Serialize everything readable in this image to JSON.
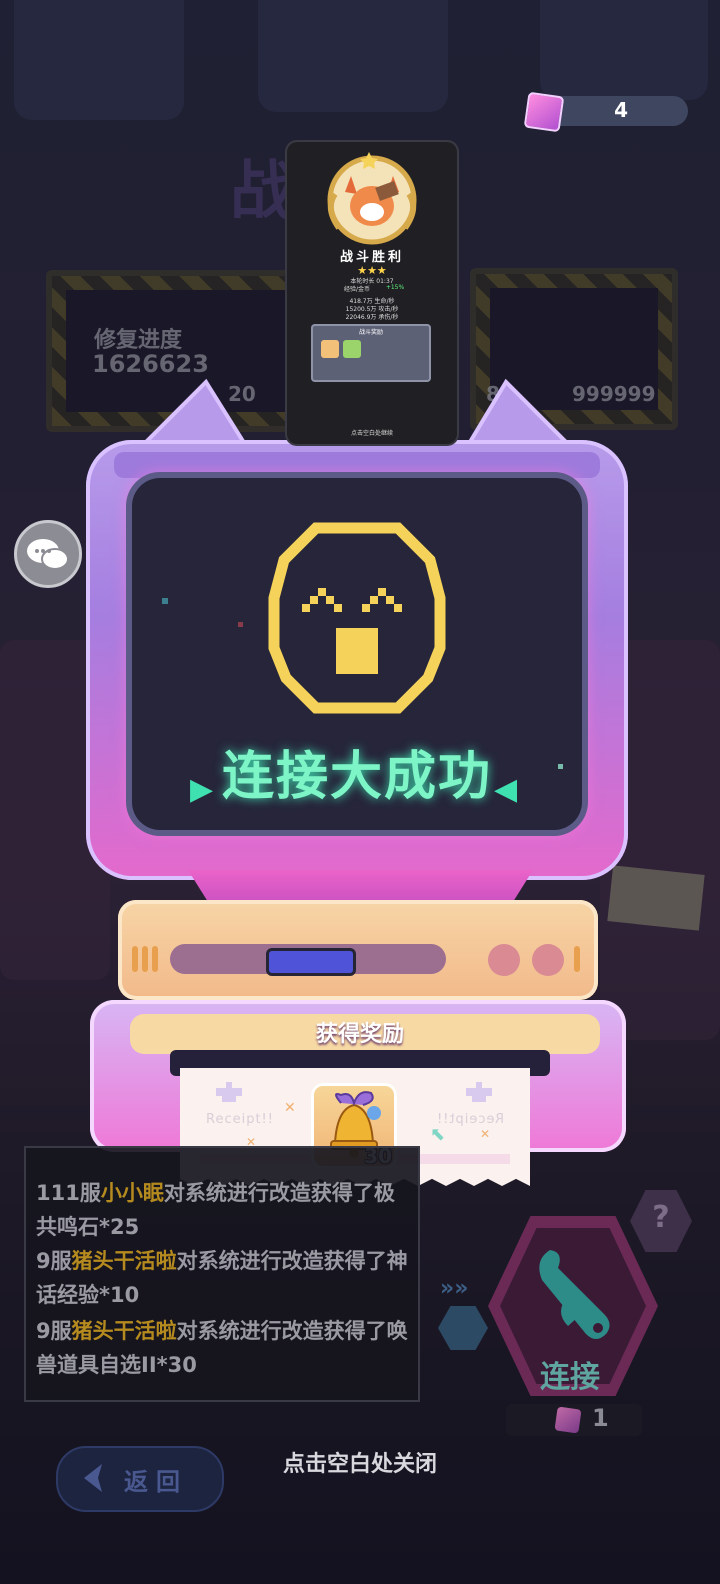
{
  "currency": {
    "icon": "crystal-icon",
    "value": "4"
  },
  "background": {
    "title": "战斗",
    "repair_label": "修复进度",
    "repair_value": "1626623",
    "left_number": "20",
    "right_numbers": [
      "80",
      "999999"
    ]
  },
  "mini_card": {
    "title": "战斗胜利",
    "stars": "★★★",
    "time_label": "本轮时长 01:37",
    "exp_label": "经验/金币",
    "exp_bonus": "+15%",
    "stat_lines": [
      "418.7万 生命/秒",
      "15200.5万 攻击/秒",
      "22046.9万 承伤/秒"
    ],
    "reward_header": "战斗奖励",
    "footer": "点击空白处继续"
  },
  "screen": {
    "title": "连接大成功",
    "face_icon": "pixel-surprised-face-icon"
  },
  "reward": {
    "title": "获得奖励",
    "item_icon": "bell-icon",
    "item_count": "30",
    "watermark_left": "Receipt!!",
    "watermark_right": "Receipt!!"
  },
  "log": {
    "entries": [
      {
        "server": "111服",
        "player": "小小眠",
        "text": "对系统进行改造获得了极共鸣石*25"
      },
      {
        "server": "9服",
        "player": "猪头干活啦",
        "text": "对系统进行改造获得了神话经验*10"
      },
      {
        "server": "9服",
        "player": "猪头干活啦",
        "text": "对系统进行改造获得了唤兽道具自选II*30"
      }
    ]
  },
  "connect": {
    "label": "连接",
    "cost": "1",
    "icon": "wrench-icon"
  },
  "help": {
    "label": "?"
  },
  "back": {
    "label": "返回"
  },
  "close_hint": "点击空白处关闭",
  "colors": {
    "screen_text": "#7df5c6",
    "face": "#f5d25a",
    "monitor": "#b79bea",
    "accent_pink": "#e469cc"
  }
}
